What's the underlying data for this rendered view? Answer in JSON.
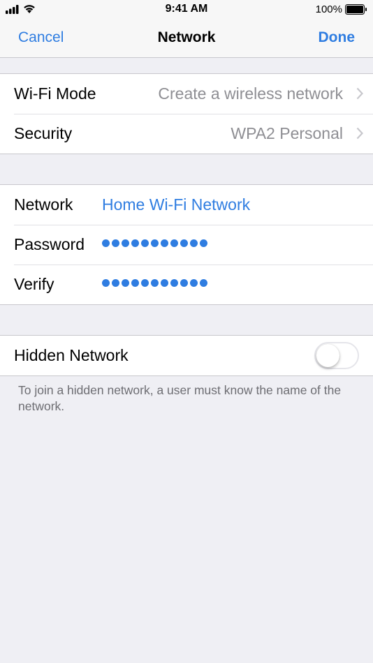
{
  "status_bar": {
    "time": "9:41 AM",
    "battery_percent": "100%",
    "signal_icon": "signal-bars-icon",
    "wifi_icon": "wifi-icon",
    "battery_icon": "battery-full-icon"
  },
  "nav": {
    "cancel_label": "Cancel",
    "title": "Network",
    "done_label": "Done"
  },
  "mode_group": {
    "wifi_mode_label": "Wi-Fi Mode",
    "wifi_mode_value": "Create a wireless network",
    "security_label": "Security",
    "security_value": "WPA2 Personal"
  },
  "credentials_group": {
    "network_label": "Network",
    "network_value": "Home Wi-Fi Network",
    "password_label": "Password",
    "password_length": 11,
    "verify_label": "Verify",
    "verify_length": 11
  },
  "hidden_group": {
    "hidden_label": "Hidden Network",
    "hidden_enabled": false,
    "note": "To join a hidden network, a user must know the name of the network."
  },
  "colors": {
    "accent": "#2f7de1",
    "background": "#efeff4",
    "secondary_text": "#8e8e93"
  }
}
